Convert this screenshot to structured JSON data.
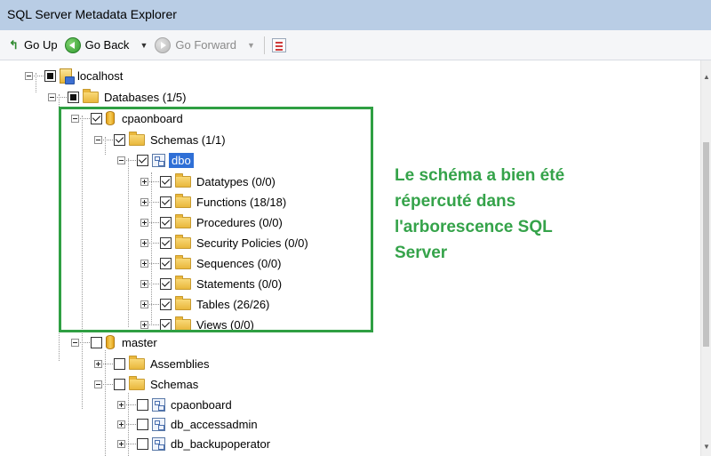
{
  "window": {
    "title": "SQL Server Metadata Explorer"
  },
  "toolbar": {
    "go_up": "Go Up",
    "go_back": "Go Back",
    "go_forward": "Go Forward"
  },
  "tree": {
    "root": "localhost",
    "databases": "Databases (1/5)",
    "cpaonboard": "cpaonboard",
    "schemas_cpa": "Schemas (1/1)",
    "dbo": "dbo",
    "datatypes": "Datatypes (0/0)",
    "functions": "Functions (18/18)",
    "procedures": "Procedures (0/0)",
    "security": "Security Policies (0/0)",
    "sequences": "Sequences (0/0)",
    "statements": "Statements (0/0)",
    "tables": "Tables (26/26)",
    "views": "Views (0/0)",
    "master": "master",
    "assemblies": "Assemblies",
    "schemas_master": "Schemas",
    "m_cpaonboard": "cpaonboard",
    "db_accessadmin": "db_accessadmin",
    "db_backupoperator": "db_backupoperator"
  },
  "annotation": {
    "line1": "Le schéma a bien été",
    "line2": "répercuté dans",
    "line3": "l'arborescence SQL",
    "line4": "Server"
  },
  "colors": {
    "title_bar": "#b9cde5",
    "highlight": "#2f9f43",
    "annotation_text": "#35a34a",
    "selection": "#2f6fd6"
  }
}
